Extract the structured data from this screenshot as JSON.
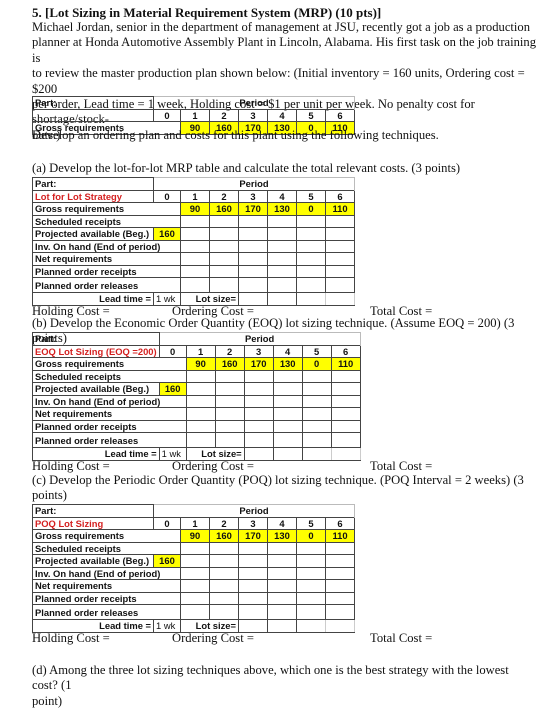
{
  "question": {
    "title": "5. [Lot Sizing in Material Requirement System (MRP) (10 pts)]",
    "paragraph_lines": [
      "Michael Jordan, senior in the department of management at JSU, recently got a job as a production",
      "planner at Honda Automotive Assembly Plant in Lincoln, Alabama. His first task on the job training is",
      "to review the master production plan shown below: (Initial inventory = 160 units, Ordering cost = $200",
      "per order, Lead time = 1 week, Holding cost = $1 per unit per week. No penalty cost for shortage/stock-",
      "outs.)"
    ],
    "instruction": "Develop an ordering plan and costs for this plant using the following techniques."
  },
  "master_table": {
    "part_label": "Part:",
    "period_label": "Period",
    "periods": [
      "0",
      "1",
      "2",
      "3",
      "4",
      "5",
      "6"
    ],
    "gross_label": "Gross requirements",
    "gross": [
      "90",
      "160",
      "170",
      "130",
      "0",
      "110"
    ]
  },
  "sections": [
    {
      "prompt_lines": [
        "(a) Develop the lot-for-lot MRP table and calculate the total relevant costs. (3 points)"
      ],
      "strategy": "Lot for Lot Strategy"
    },
    {
      "prompt_lines": [
        "(b) Develop the Economic Order Quantity (EOQ) lot sizing technique. (Assume EOQ = 200) (3 points)"
      ],
      "strategy": "EOQ Lot Sizing (EOQ =200)"
    },
    {
      "prompt_lines": [
        "(c) Develop the Periodic Order Quantity (POQ) lot sizing technique. (POQ Interval = 2 weeks) (3",
        "points)"
      ],
      "strategy": "POQ Lot Sizing"
    }
  ],
  "mrp_rows": {
    "part_label": "Part:",
    "period_label": "Period",
    "gross_label": "Gross requirements",
    "scheduled_label": "Scheduled receipts",
    "projected_label": "Projected available (Beg.)",
    "projected_initial": "160",
    "onhand_label": "Inv. On hand (End of period)",
    "net_label": "Net requirements",
    "receipts_label": "Planned order receipts",
    "releases_label": "Planned order releases",
    "lead_time_label": "Lead time =",
    "lead_time_value": "1 wk",
    "lot_size_label": "Lot size="
  },
  "costs": {
    "holding": "Holding Cost =",
    "ordering": "Ordering Cost =",
    "total": "Total Cost ="
  },
  "final_question": {
    "lines": [
      "(d) Among the three lot sizing techniques above, which one is the best strategy with the lowest cost? (1",
      "point)"
    ]
  },
  "colors": {
    "highlight": "#ffff00",
    "strategy_text": "#d42020"
  }
}
